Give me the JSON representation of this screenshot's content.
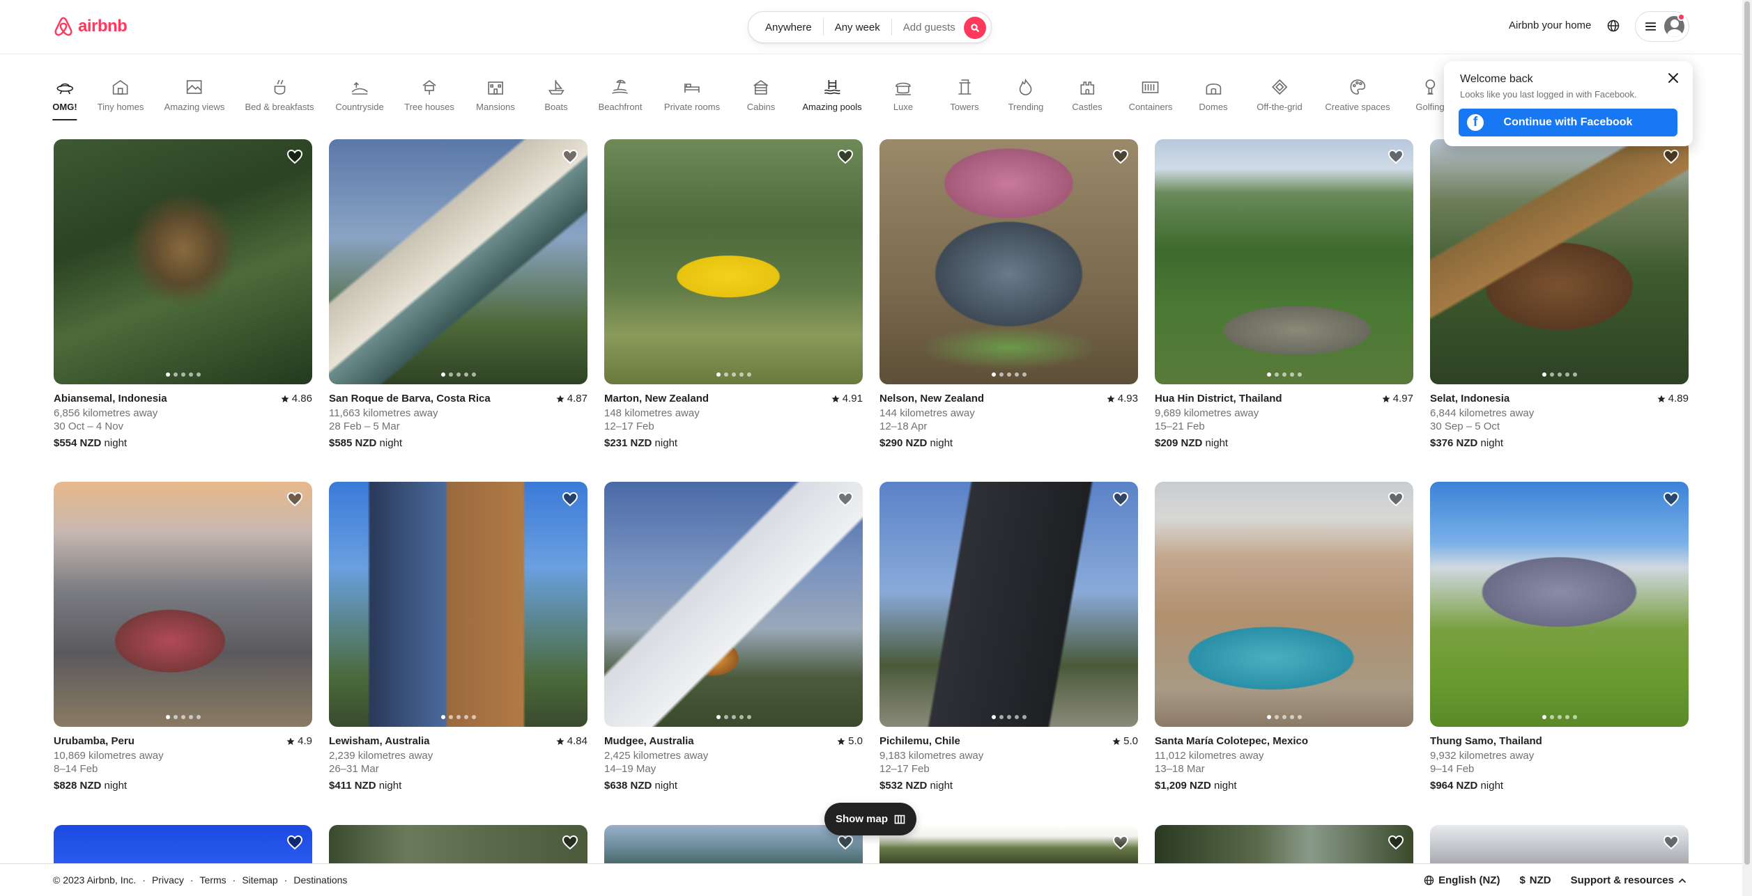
{
  "header": {
    "logo_text": "airbnb",
    "search": {
      "anywhere": "Anywhere",
      "any_week": "Any week",
      "add_guests": "Add guests"
    },
    "host_link": "Airbnb your home"
  },
  "categories": [
    {
      "label": "OMG!",
      "icon": "ufo-icon",
      "active": true
    },
    {
      "label": "Tiny homes",
      "icon": "tiny-home-icon"
    },
    {
      "label": "Amazing views",
      "icon": "view-icon"
    },
    {
      "label": "Bed & breakfasts",
      "icon": "breakfast-icon"
    },
    {
      "label": "Countryside",
      "icon": "countryside-icon"
    },
    {
      "label": "Tree houses",
      "icon": "treehouse-icon"
    },
    {
      "label": "Mansions",
      "icon": "mansion-icon"
    },
    {
      "label": "Boats",
      "icon": "boat-icon"
    },
    {
      "label": "Beachfront",
      "icon": "beach-icon"
    },
    {
      "label": "Private rooms",
      "icon": "bed-icon"
    },
    {
      "label": "Cabins",
      "icon": "cabin-icon"
    },
    {
      "label": "Amazing pools",
      "icon": "pool-icon"
    },
    {
      "label": "Luxe",
      "icon": "luxe-icon"
    },
    {
      "label": "Towers",
      "icon": "tower-icon"
    },
    {
      "label": "Trending",
      "icon": "flame-icon"
    },
    {
      "label": "Castles",
      "icon": "castle-icon"
    },
    {
      "label": "Containers",
      "icon": "container-icon"
    },
    {
      "label": "Domes",
      "icon": "dome-icon"
    },
    {
      "label": "Off-the-grid",
      "icon": "off-grid-icon"
    },
    {
      "label": "Creative spaces",
      "icon": "creative-icon"
    },
    {
      "label": "Golfing",
      "icon": "golf-icon"
    }
  ],
  "popup": {
    "title": "Welcome back",
    "subtitle": "Looks like you last logged in with Facebook.",
    "button": "Continue with Facebook"
  },
  "listings": [
    {
      "location": "Abiansemal, Indonesia",
      "rating": "4.86",
      "distance": "6,856 kilometres away",
      "dates": "30 Oct – 4 Nov",
      "price": "$554 NZD",
      "unit": "night"
    },
    {
      "location": "San Roque de Barva, Costa Rica",
      "rating": "4.87",
      "distance": "11,663 kilometres away",
      "dates": "28 Feb – 5 Mar",
      "price": "$585 NZD",
      "unit": "night"
    },
    {
      "location": "Marton, New Zealand",
      "rating": "4.91",
      "distance": "148 kilometres away",
      "dates": "12–17 Feb",
      "price": "$231 NZD",
      "unit": "night"
    },
    {
      "location": "Nelson, New Zealand",
      "rating": "4.93",
      "distance": "144 kilometres away",
      "dates": "12–18 Apr",
      "price": "$290 NZD",
      "unit": "night"
    },
    {
      "location": "Hua Hin District, Thailand",
      "rating": "4.97",
      "distance": "9,689 kilometres away",
      "dates": "15–21 Feb",
      "price": "$209 NZD",
      "unit": "night"
    },
    {
      "location": "Selat, Indonesia",
      "rating": "4.89",
      "distance": "6,844 kilometres away",
      "dates": "30 Sep – 5 Oct",
      "price": "$376 NZD",
      "unit": "night"
    },
    {
      "location": "Urubamba, Peru",
      "rating": "4.9",
      "distance": "10,869 kilometres away",
      "dates": "8–14 Feb",
      "price": "$828 NZD",
      "unit": "night"
    },
    {
      "location": "Lewisham, Australia",
      "rating": "4.84",
      "distance": "2,239 kilometres away",
      "dates": "26–31 Mar",
      "price": "$411 NZD",
      "unit": "night"
    },
    {
      "location": "Mudgee, Australia",
      "rating": "5.0",
      "distance": "2,425 kilometres away",
      "dates": "14–19 May",
      "price": "$638 NZD",
      "unit": "night"
    },
    {
      "location": "Pichilemu, Chile",
      "rating": "5.0",
      "distance": "9,183 kilometres away",
      "dates": "12–17 Feb",
      "price": "$532 NZD",
      "unit": "night"
    },
    {
      "location": "Santa María Colotepec, Mexico",
      "rating": "",
      "distance": "11,012 kilometres away",
      "dates": "13–18 Mar",
      "price": "$1,209 NZD",
      "unit": "night"
    },
    {
      "location": "Thung Samo, Thailand",
      "rating": "",
      "distance": "9,932 kilometres away",
      "dates": "9–14 Feb",
      "price": "$964 NZD",
      "unit": "night"
    }
  ],
  "show_map": "Show map",
  "footer": {
    "copyright": "© 2023 Airbnb, Inc.",
    "links": [
      "Privacy",
      "Terms",
      "Sitemap",
      "Destinations"
    ],
    "language": "English (NZ)",
    "currency_symbol": "$",
    "currency": "NZD",
    "support": "Support & resources"
  },
  "colors": {
    "brand": "#ff385c",
    "facebook": "#1877f2",
    "text": "#222222",
    "muted": "#717171"
  }
}
